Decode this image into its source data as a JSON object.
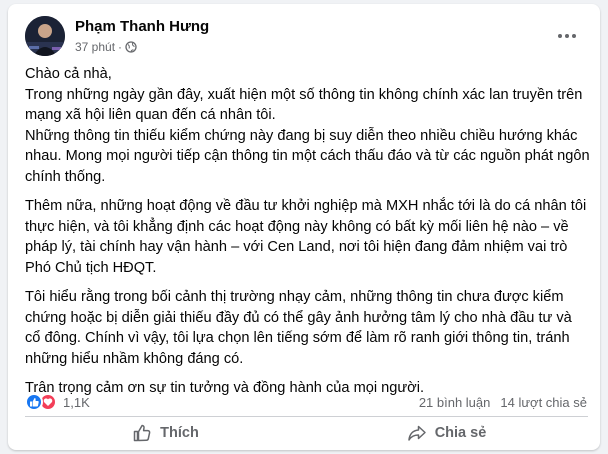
{
  "post": {
    "author": "Phạm Thanh Hưng",
    "time": "37 phút",
    "separator": "·",
    "privacy_icon": "globe-icon",
    "more_icon": "more-options-icon",
    "paragraphs": [
      "Chào cả nhà,\nTrong những ngày gần đây,  xuất hiện một số thông tin   không chính xác lan truyền trên mạng xã hội  liên quan đến cá nhân tôi.\nNhững thông tin thiếu kiểm chứng này đang bị suy diễn theo nhiều chiều hướng khác nhau. Mong mọi người tiếp cận thông tin một cách thấu đáo và từ các nguồn phát ngôn chính thống.",
      "Thêm nữa, những hoạt động về đầu tư khởi nghiệp mà MXH nhắc tới là do cá nhân tôi thực hiện, và tôi khẳng định các hoạt động  này không có bất kỳ mối liên hệ nào – về pháp lý, tài chính hay vận hành – với Cen Land, nơi tôi hiện đang đảm nhiệm vai trò Phó Chủ tịch HĐQT.",
      "Tôi hiểu rằng trong bối cảnh thị trường nhạy cảm, những thông tin chưa được kiểm chứng hoặc bị diễn giải thiếu đầy đủ có thể gây ảnh hưởng tâm lý cho nhà đầu tư và cổ đông. Chính vì vậy, tôi lựa chọn lên tiếng sớm để làm rõ ranh giới thông tin, tránh những hiểu nhầm không đáng có.",
      "Trân trọng cảm ơn sự tin tưởng và đồng hành của mọi người."
    ]
  },
  "stats": {
    "reactions": "1,1K",
    "comments": "21 bình luận",
    "shares": "14 lượt chia sẻ"
  },
  "actions": {
    "like_label": "Thích",
    "share_label": "Chia sẻ"
  },
  "colors": {
    "like_blue": "#1877f2",
    "love_red": "#f33e58",
    "secondary_text": "#65676b"
  }
}
